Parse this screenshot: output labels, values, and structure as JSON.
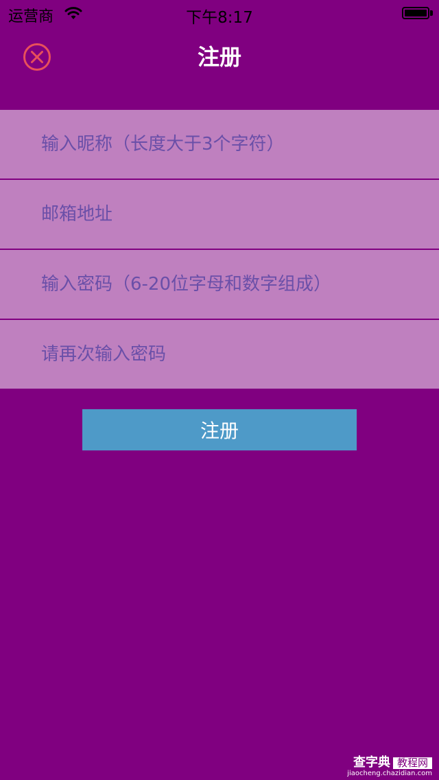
{
  "status_bar": {
    "carrier": "运营商",
    "time": "下午8:17"
  },
  "nav": {
    "title": "注册",
    "close_icon": "close-circle-icon",
    "close_color": "#e8505b"
  },
  "form": {
    "nickname_placeholder": "输入昵称（长度大于3个字符）",
    "email_placeholder": "邮箱地址",
    "password_placeholder": "输入密码（6-20位字母和数字组成）",
    "confirm_placeholder": "请再次输入密码"
  },
  "actions": {
    "register_label": "注册"
  },
  "watermark": {
    "brand": "查字典",
    "tag": "教程网",
    "url": "jiaocheng.chazidian.com"
  },
  "colors": {
    "background": "#800080",
    "field": "#bf80bf",
    "button": "#4e9ac8"
  }
}
